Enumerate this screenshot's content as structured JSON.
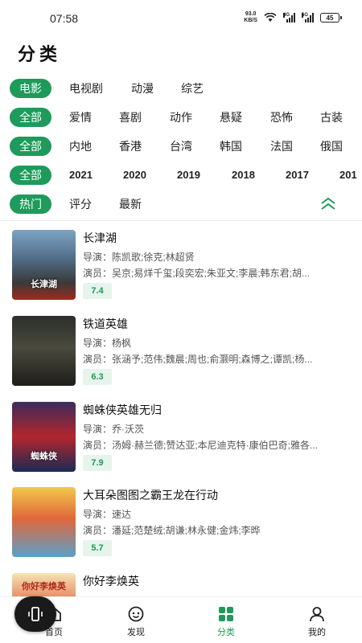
{
  "status_bar": {
    "time": "07:58",
    "net_speed_value": "93.0",
    "net_speed_unit": "KB/S",
    "signal1_label": "4G",
    "signal2_label": "5G",
    "battery": "45"
  },
  "page": {
    "title": "分类"
  },
  "filters": {
    "type": {
      "items": [
        "电影",
        "电视剧",
        "动漫",
        "综艺"
      ],
      "active": 0
    },
    "genre": {
      "items": [
        "全部",
        "爱情",
        "喜剧",
        "动作",
        "悬疑",
        "恐怖",
        "古装"
      ],
      "active": 0
    },
    "region": {
      "items": [
        "全部",
        "内地",
        "香港",
        "台湾",
        "韩国",
        "法国",
        "俄国"
      ],
      "active": 0
    },
    "year": {
      "items": [
        "全部",
        "2021",
        "2020",
        "2019",
        "2018",
        "2017",
        "201"
      ],
      "active": 0
    },
    "sort": {
      "items": [
        "热门",
        "评分",
        "最新"
      ],
      "active": 0
    },
    "collapse_icon": "chevron-double-up-icon"
  },
  "movies": [
    {
      "title": "长津湖",
      "director": "导演：陈凯歌;徐克;林超贤",
      "cast": "演员：吴京;易烊千玺;段奕宏;朱亚文;李晨;韩东君;胡...",
      "score": "7.4",
      "poster_text": "长津湖"
    },
    {
      "title": "铁道英雄",
      "director": "导演：杨枫",
      "cast": "演员：张涵予;范伟;魏晨;周也;俞灏明;森博之;谭凯;杨...",
      "score": "6.3",
      "poster_text": ""
    },
    {
      "title": "蜘蛛侠英雄无归",
      "director": "导演：乔·沃茨",
      "cast": "演员：汤姆·赫兰德;赞达亚;本尼迪克特·康伯巴奇;雅各...",
      "score": "7.9",
      "poster_text": "蜘蛛侠"
    },
    {
      "title": "大耳朵图图之霸王龙在行动",
      "director": "导演：速达",
      "cast": "演员：潘延;范楚绒;胡谦;林永健;金炜;李晔",
      "score": "5.7",
      "poster_text": ""
    },
    {
      "title": "你好李焕英",
      "director": "",
      "cast": "",
      "score": "",
      "poster_text": "你好李焕英"
    }
  ],
  "bottom_nav": {
    "items": [
      {
        "label": "首页",
        "icon": "home-icon"
      },
      {
        "label": "发现",
        "icon": "discover-icon"
      },
      {
        "label": "分类",
        "icon": "category-grid-icon"
      },
      {
        "label": "我的",
        "icon": "profile-icon"
      }
    ],
    "active": 2
  },
  "colors": {
    "accent": "#1e9a5b",
    "score_bg": "#e6f4eb"
  }
}
